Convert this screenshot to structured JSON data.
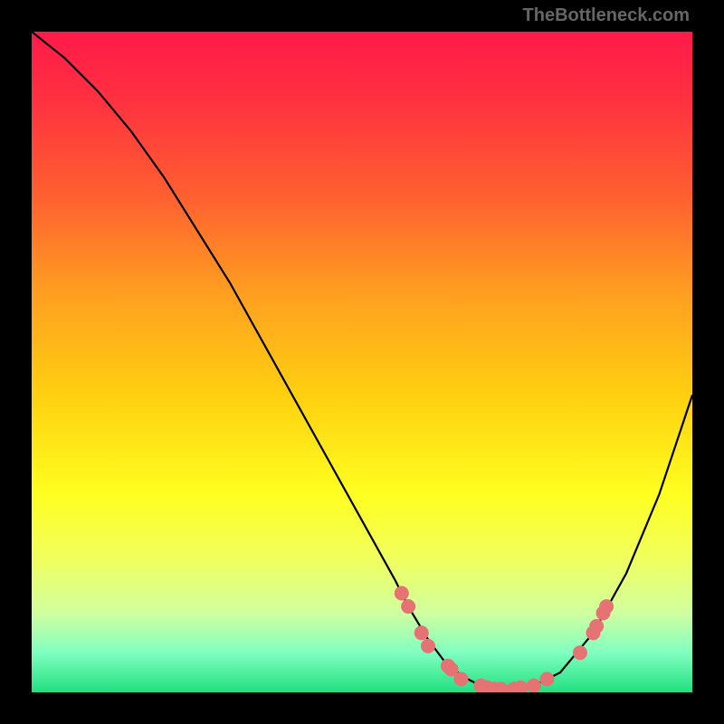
{
  "watermark": "TheBottleneck.com",
  "chart_data": {
    "type": "line",
    "title": "",
    "xlabel": "",
    "ylabel": "",
    "xlim": [
      0,
      100
    ],
    "ylim": [
      0,
      100
    ],
    "curve": {
      "name": "bottleneck-curve",
      "x": [
        0,
        5,
        10,
        15,
        20,
        25,
        30,
        35,
        40,
        45,
        50,
        55,
        57,
        60,
        63,
        66,
        68,
        70,
        73,
        76,
        80,
        85,
        90,
        95,
        100
      ],
      "y": [
        100,
        96,
        91,
        85,
        78,
        70,
        62,
        53,
        44,
        35,
        26,
        17,
        13,
        8,
        4,
        2,
        1,
        0.5,
        0.5,
        1,
        3,
        9,
        18,
        30,
        45
      ]
    },
    "dots": {
      "name": "highlight-dots",
      "color": "#e57373",
      "points": [
        {
          "x": 56,
          "y": 15
        },
        {
          "x": 57,
          "y": 13
        },
        {
          "x": 59,
          "y": 9
        },
        {
          "x": 60,
          "y": 7
        },
        {
          "x": 63,
          "y": 4
        },
        {
          "x": 63.5,
          "y": 3.5
        },
        {
          "x": 65,
          "y": 2
        },
        {
          "x": 68,
          "y": 1
        },
        {
          "x": 69,
          "y": 0.7
        },
        {
          "x": 70,
          "y": 0.5
        },
        {
          "x": 71,
          "y": 0.5
        },
        {
          "x": 73,
          "y": 0.5
        },
        {
          "x": 74,
          "y": 0.7
        },
        {
          "x": 76,
          "y": 1
        },
        {
          "x": 78,
          "y": 2
        },
        {
          "x": 83,
          "y": 6
        },
        {
          "x": 85,
          "y": 9
        },
        {
          "x": 85.5,
          "y": 10
        },
        {
          "x": 86.5,
          "y": 12
        },
        {
          "x": 87,
          "y": 13
        }
      ]
    }
  }
}
